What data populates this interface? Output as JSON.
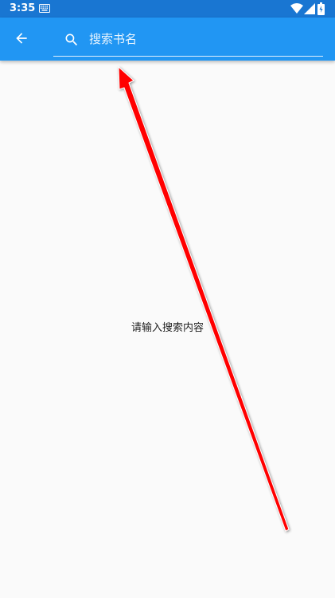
{
  "status_bar": {
    "time": "3:35",
    "icons": [
      "keyboard-icon",
      "wifi-icon",
      "signal-icon",
      "battery-icon"
    ]
  },
  "app_bar": {
    "back_icon": "arrow-back-icon",
    "search": {
      "icon": "search-icon",
      "placeholder": "搜索书名",
      "value": ""
    }
  },
  "content": {
    "empty_message": "请输入搜索内容"
  },
  "colors": {
    "status_bar": "#1976d2",
    "app_bar": "#2196f3",
    "background": "#fafafa",
    "annotation": "#ff0000"
  }
}
